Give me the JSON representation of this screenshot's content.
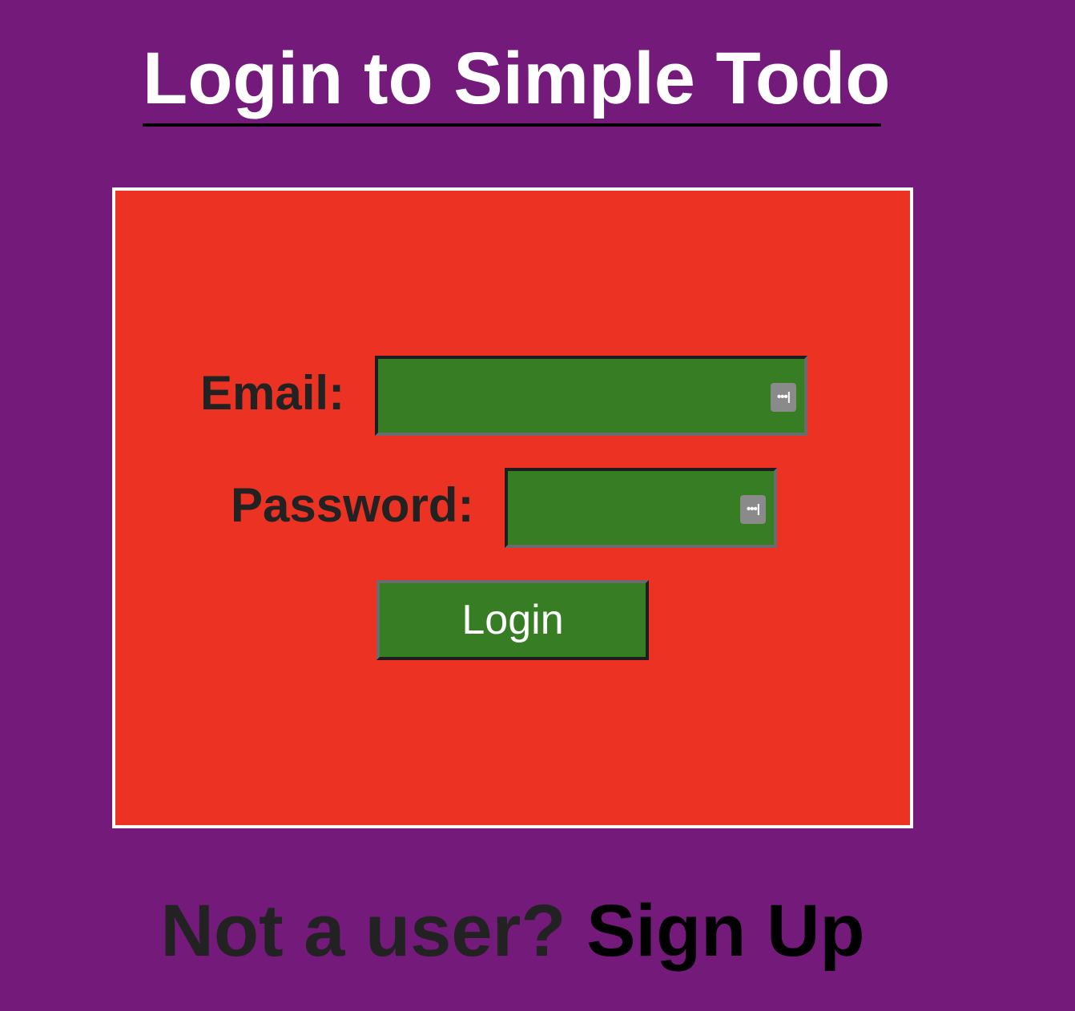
{
  "page": {
    "title": "Login to Simple Todo"
  },
  "form": {
    "email_label": "Email:",
    "email_value": "",
    "password_label": "Password:",
    "password_value": "",
    "autofill_icon": "password-autofill-key",
    "autofill_glyph": "•••|",
    "login_label": "Login"
  },
  "footer": {
    "prompt": "Not a user?",
    "signup_label": "Sign Up"
  },
  "colors": {
    "background": "#741a7a",
    "panel": "#ec3223",
    "panel_border": "#ffffff",
    "field": "#367d23",
    "title_text": "#ffffff",
    "label_text": "#222222"
  }
}
